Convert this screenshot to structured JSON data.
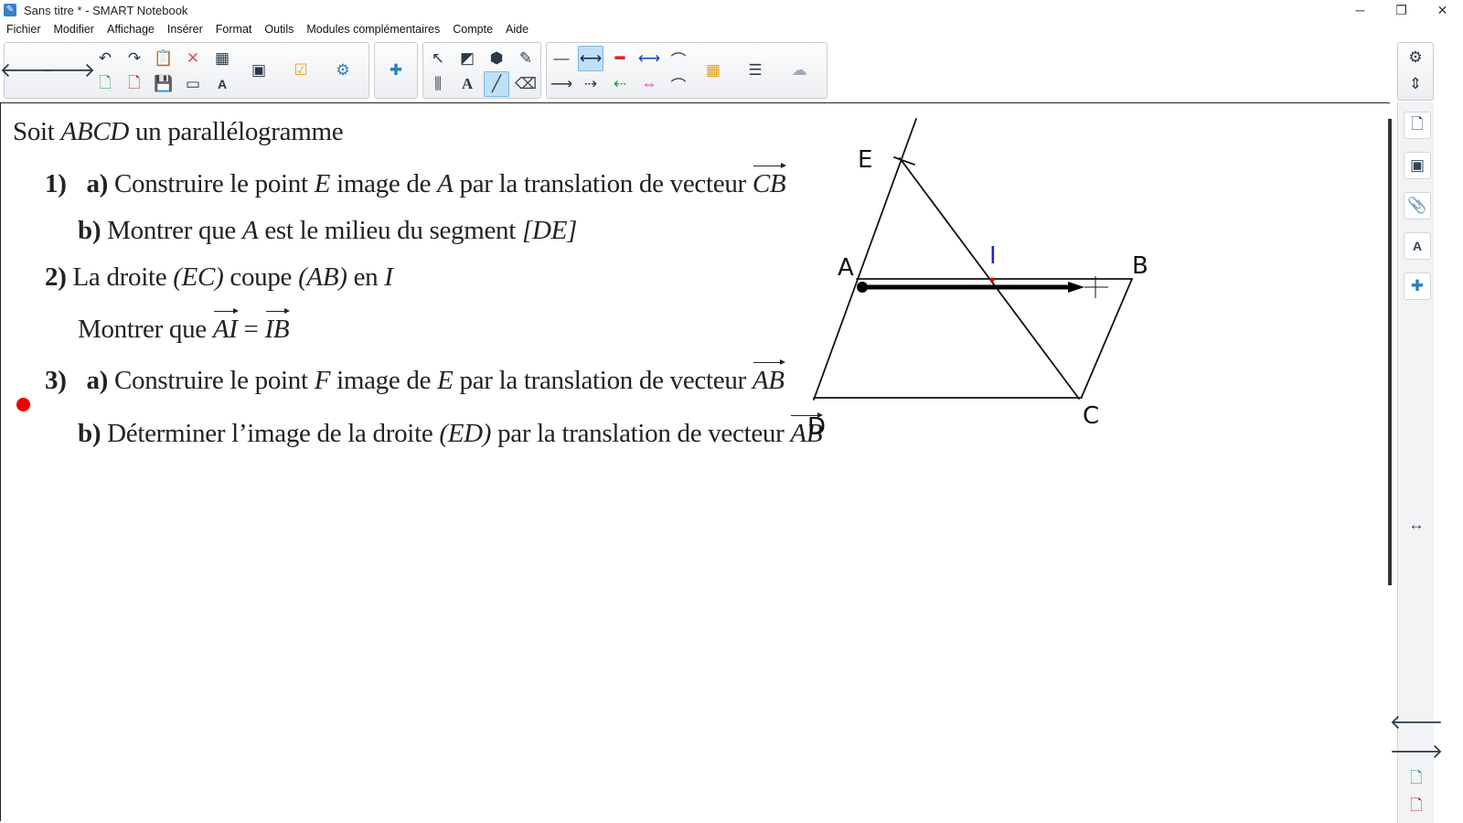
{
  "window": {
    "title": "Sans titre * - SMART Notebook",
    "controls": [
      "─",
      "❐",
      "✕"
    ]
  },
  "menu": [
    "Fichier",
    "Modifier",
    "Affichage",
    "Insérer",
    "Format",
    "Outils",
    "Modules complémentaires",
    "Compte",
    "Aide"
  ],
  "doc": {
    "intro_1": "Soit ",
    "intro_var": "ABCD",
    "intro_2": " un parallélogramme",
    "q1_num": "1)",
    "q1a_lbl": "a)",
    "q1a_text": " Construire le point ",
    "q1a_E": "E",
    "q1a_mid": " image de ",
    "q1a_A": "A",
    "q1a_end": " par la translation de vecteur ",
    "q1a_vec": "CB",
    "q1b_lbl": "b)",
    "q1b_text": " Montrer que ",
    "q1b_A": "A",
    "q1b_mid": " est le milieu du segment ",
    "q1b_seg": "[DE]",
    "q2_num": "2)",
    "q2_text1": " La droite ",
    "q2_EC": "(EC)",
    "q2_text2": " coupe ",
    "q2_AB": "(AB)",
    "q2_text3": " en ",
    "q2_I": "I",
    "q2b_text": "Montrer que ",
    "q2b_vec1": "AI",
    "q2b_eq": " = ",
    "q2b_vec2": "IB",
    "q3_num": "3)",
    "q3a_lbl": "a)",
    "q3a_text": " Construire le point ",
    "q3a_F": "F",
    "q3a_mid": " image de ",
    "q3a_E": "E",
    "q3a_end": " par la translation de vecteur ",
    "q3a_vec": "AB",
    "q3b_lbl": "b)",
    "q3b_text": " Déterminer l’image de la droite ",
    "q3b_ED": "(ED)",
    "q3b_end": " par la translation de vecteur ",
    "q3b_vec": "AB"
  },
  "figure": {
    "labels": {
      "E": "E",
      "A": "A",
      "I": "I",
      "B": "B",
      "D": "D",
      "C": "C"
    },
    "colors": {
      "ink": "#111111",
      "label_I": "#1e22d8",
      "point_I": "#e00000",
      "pen_dot": "#e00000"
    }
  },
  "icons": {
    "toolbar": [
      "back-arrow-icon",
      "forward-arrow-icon",
      "undo-icon",
      "redo-icon",
      "paste-icon",
      "delete-icon",
      "table-icon",
      "add-page-icon",
      "delete-page-icon",
      "save-icon",
      "screen-shade-icon",
      "screen-capture-icon",
      "text-recognition-icon",
      "response-icon",
      "activity-builder-icon",
      "addons-icon",
      "select-icon",
      "shapes-icon",
      "fill-icon",
      "pen-icon",
      "measure-icon",
      "text-tool-icon",
      "line-tool-icon",
      "eraser-icon",
      "color-palette-icon",
      "line-props-icon",
      "cloud-icon",
      "settings-icon",
      "move-toolbar-icon"
    ],
    "sidebar": [
      "page-sorter-icon",
      "gallery-icon",
      "attachments-icon",
      "properties-icon",
      "addons-icon",
      "resize-icon",
      "prev-page-icon",
      "next-page-icon",
      "new-page-icon",
      "delete-page-icon"
    ]
  }
}
